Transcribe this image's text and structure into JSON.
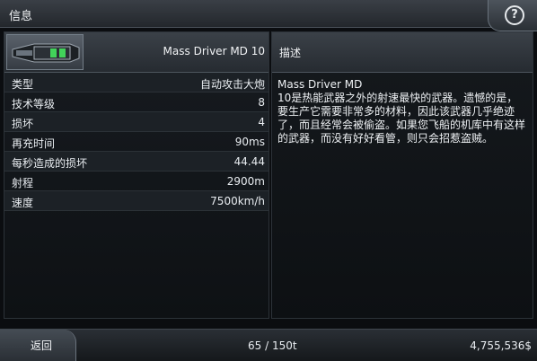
{
  "header": {
    "title": "信息"
  },
  "item": {
    "name": "Mass Driver MD 10",
    "stats": [
      {
        "label": "类型",
        "value": "自动攻击大炮"
      },
      {
        "label": "技术等级",
        "value": "8"
      },
      {
        "label": "损坏",
        "value": "4"
      },
      {
        "label": "再充时间",
        "value": "90ms"
      },
      {
        "label": "每秒造成的损坏",
        "value": "44.44"
      },
      {
        "label": "射程",
        "value": "2900m"
      },
      {
        "label": "速度",
        "value": "7500km/h"
      }
    ]
  },
  "description": {
    "title": "描述",
    "name": "Mass Driver MD",
    "text": "10是热能武器之外的射速最快的武器。遗憾的是，要生产它需要非常多的材料，因此该武器几乎绝迹了，而且经常会被偷盗。如果您飞船的机库中有这样的武器，而没有好好看管，则只会招惹盗贼。"
  },
  "footer": {
    "back_label": "返回",
    "cargo": "65 / 150t",
    "money": "4,755,536$"
  }
}
